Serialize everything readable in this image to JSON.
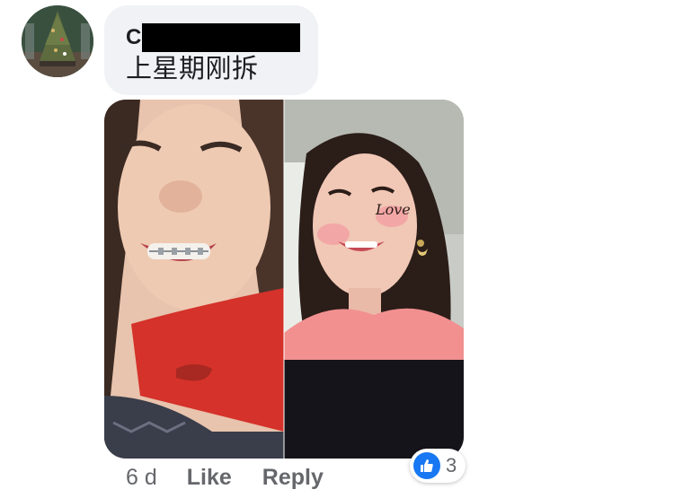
{
  "comment": {
    "author_visible_initial": "C",
    "author_redacted": true,
    "text": "上星期刚拆",
    "timestamp": "6 d",
    "like_label": "Like",
    "reply_label": "Reply"
  },
  "reactions": {
    "icon": "thumbs-up-icon",
    "count": "3",
    "color": "#1877f2"
  },
  "photo": {
    "sticker_text": "Love"
  },
  "colors": {
    "bubble": "#f0f2f5",
    "text": "#1c1e21",
    "meta": "#65676b",
    "accent": "#1877f2"
  }
}
